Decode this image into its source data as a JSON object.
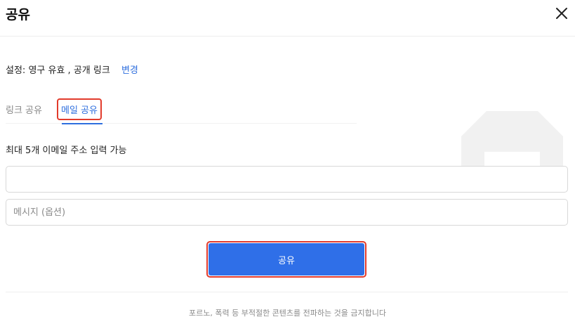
{
  "dialog": {
    "title": "공유",
    "close_icon": "close-icon"
  },
  "settings": {
    "label": "설정:",
    "value": "영구 유효 , 공개 링크",
    "change_label": "변경"
  },
  "tabs": [
    {
      "label": "링크 공유",
      "active": false
    },
    {
      "label": "메일 공유",
      "active": true
    }
  ],
  "form": {
    "limit_label": "최대 5개 이메일 주소 입력 가능",
    "email_value": "",
    "email_placeholder": "",
    "message_placeholder": "메시지 (옵션)"
  },
  "share_button": {
    "label": "공유"
  },
  "footer": {
    "note": "포르노, 폭력 등 부적절한 콘텐츠를 전파하는 것을 금지합니다"
  },
  "colors": {
    "accent": "#2f6fe8",
    "highlight_border": "#e23b2c"
  }
}
